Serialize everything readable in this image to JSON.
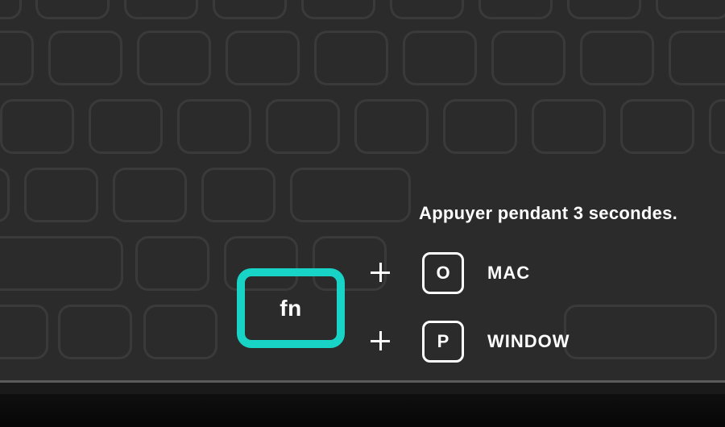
{
  "instruction": "Appuyer pendant 3 secondes.",
  "fn_key": {
    "label": "fn"
  },
  "combo1": {
    "letter": "O",
    "os": "MAC"
  },
  "combo2": {
    "letter": "P",
    "os": "WINDOW"
  }
}
